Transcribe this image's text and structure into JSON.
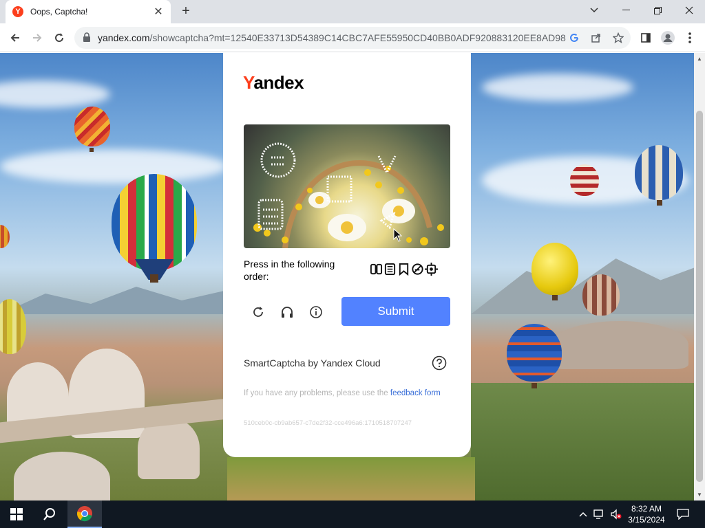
{
  "browser": {
    "tab": {
      "title": "Oops, Captcha!",
      "favicon": "Y"
    },
    "url": {
      "host": "yandex.com",
      "path": "/showcaptcha?mt=12540E33713D54389C14CBC7AFE55950CD40BB0ADF920883120EE8AD98C1..."
    }
  },
  "captcha": {
    "logo_first": "Y",
    "logo_rest": "andex",
    "instruction": "Press in the following order:",
    "order_icons": [
      "window-icon",
      "calculator-icon",
      "bookmark-icon",
      "no-smoking-icon",
      "gear-chip-icon"
    ],
    "submit_label": "Submit",
    "brand": "SmartCaptcha by Yandex Cloud",
    "feedback_text": "If you have any problems, please use the ",
    "feedback_link": "feedback form",
    "token": "510ceb0c-cb9ab657-c7de2f32-cce496a6:1710518707247",
    "accent_color": "#5282ff",
    "brand_color": "#fc3f1d"
  },
  "taskbar": {
    "time": "8:32 AM",
    "date": "3/15/2024"
  }
}
